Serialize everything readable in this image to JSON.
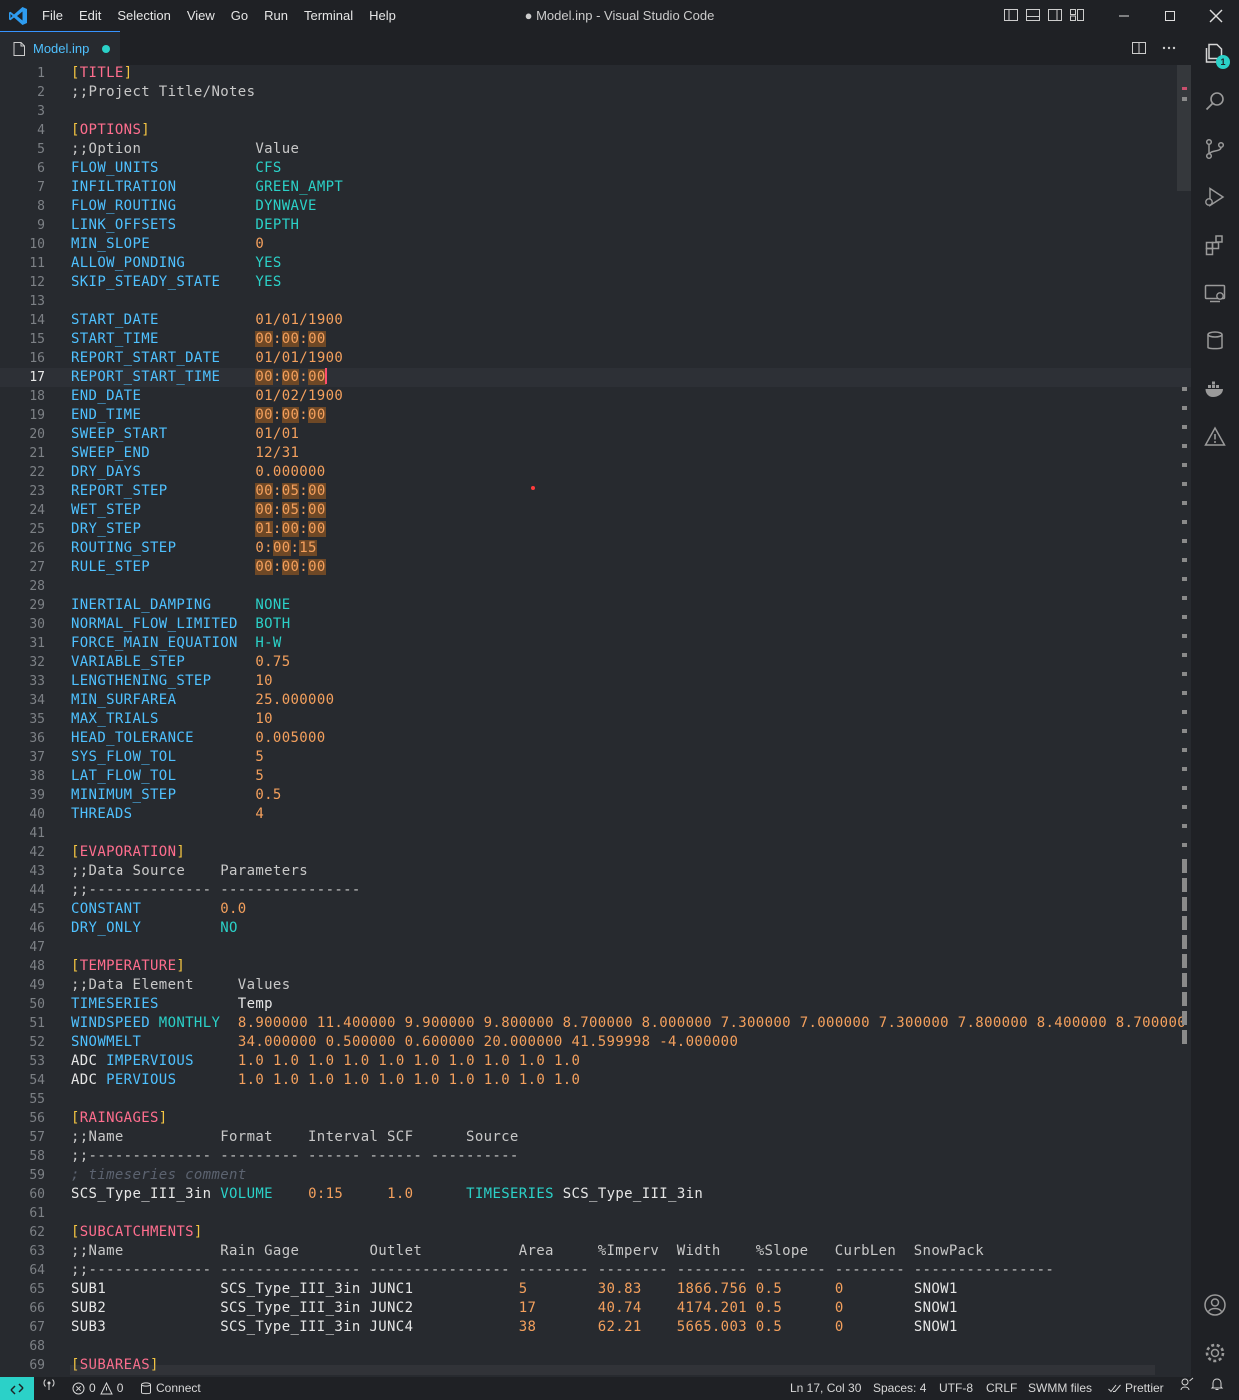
{
  "window": {
    "title": "● Model.inp - Visual Studio Code",
    "menu": [
      "File",
      "Edit",
      "Selection",
      "View",
      "Go",
      "Run",
      "Terminal",
      "Help"
    ],
    "accent_color": "#2bd1c8",
    "link_color": "#4fc1ff"
  },
  "tab": {
    "label": "Model.inp",
    "modified": true
  },
  "activity_bar": {
    "explorer_badge": "1",
    "icons": [
      "explorer-icon",
      "search-icon",
      "source-control-icon",
      "run-debug-icon",
      "extensions-icon",
      "remote-explorer-icon",
      "database-icon",
      "docker-icon",
      "warning-icon",
      "account-icon",
      "settings-gear-icon"
    ]
  },
  "editor": {
    "current_line": 17,
    "lines": [
      "[TITLE]",
      ";;Project Title/Notes",
      "",
      "[OPTIONS]",
      ";;Option             Value",
      "FLOW_UNITS           CFS",
      "INFILTRATION         GREEN_AMPT",
      "FLOW_ROUTING         DYNWAVE",
      "LINK_OFFSETS         DEPTH",
      "MIN_SLOPE            0",
      "ALLOW_PONDING        YES",
      "SKIP_STEADY_STATE    YES",
      "",
      "START_DATE           01/01/1900",
      "START_TIME           00:00:00",
      "REPORT_START_DATE    01/01/1900",
      "REPORT_START_TIME    00:00:00",
      "END_DATE             01/02/1900",
      "END_TIME             00:00:00",
      "SWEEP_START          01/01",
      "SWEEP_END            12/31",
      "DRY_DAYS             0.000000",
      "REPORT_STEP          00:05:00",
      "WET_STEP             00:05:00",
      "DRY_STEP             01:00:00",
      "ROUTING_STEP         0:00:15",
      "RULE_STEP            00:00:00",
      "",
      "INERTIAL_DAMPING     NONE",
      "NORMAL_FLOW_LIMITED  BOTH",
      "FORCE_MAIN_EQUATION  H-W",
      "VARIABLE_STEP        0.75",
      "LENGTHENING_STEP     10",
      "MIN_SURFAREA         25.000000",
      "MAX_TRIALS           10",
      "HEAD_TOLERANCE       0.005000",
      "SYS_FLOW_TOL         5",
      "LAT_FLOW_TOL         5",
      "MINIMUM_STEP         0.5",
      "THREADS              4",
      "",
      "[EVAPORATION]",
      ";;Data Source    Parameters",
      ";;-------------- ----------------",
      "CONSTANT         0.0",
      "DRY_ONLY         NO",
      "",
      "[TEMPERATURE]",
      ";;Data Element     Values",
      "TIMESERIES         Temp",
      "WINDSPEED MONTHLY  8.900000 11.400000 9.900000 9.800000 8.700000 8.000000 7.300000 7.000000 7.300000 7.800000 8.400000 8.700000",
      "SNOWMELT           34.000000 0.500000 0.600000 20.000000 41.599998 -4.000000",
      "ADC IMPERVIOUS     1.0 1.0 1.0 1.0 1.0 1.0 1.0 1.0 1.0 1.0",
      "ADC PERVIOUS       1.0 1.0 1.0 1.0 1.0 1.0 1.0 1.0 1.0 1.0",
      "",
      "[RAINGAGES]",
      ";;Name           Format    Interval SCF      Source",
      ";;-------------- --------- ------ ------ ----------",
      "; timeseries comment",
      "SCS_Type_III_3in VOLUME    0:15     1.0      TIMESERIES SCS_Type_III_3in",
      "",
      "[SUBCATCHMENTS]",
      ";;Name           Rain Gage        Outlet           Area     %Imperv  Width    %Slope   CurbLen  SnowPack",
      ";;-------------- ---------------- ---------------- -------- -------- -------- -------- -------- ----------------",
      "SUB1             SCS_Type_III_3in JUNC1            5        30.83    1866.756 0.5      0        SNOW1",
      "SUB2             SCS_Type_III_3in JUNC2            17       40.74    4174.201 0.5      0        SNOW1",
      "SUB3             SCS_Type_III_3in JUNC4            38       62.21    5665.003 0.5      0        SNOW1",
      "",
      "[SUBAREAS]"
    ]
  },
  "status_bar": {
    "problems_errors": "0",
    "problems_warnings": "0",
    "connect": "Connect",
    "cursor": "Ln 17, Col 30",
    "indent": "Spaces: 4",
    "encoding": "UTF-8",
    "eol": "CRLF",
    "language": "SWMM files",
    "formatter": "Prettier"
  }
}
